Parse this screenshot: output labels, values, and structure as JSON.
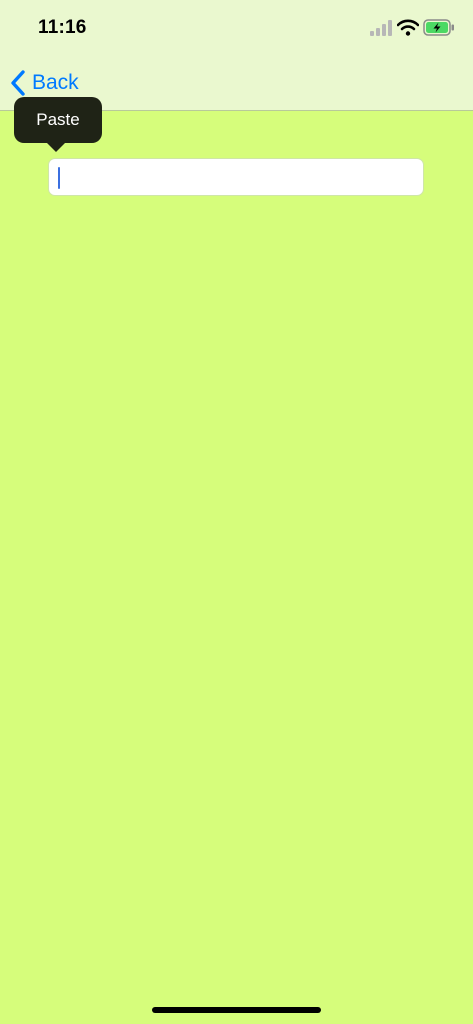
{
  "status_bar": {
    "time": "11:16",
    "icons": [
      "cellular-signal-icon",
      "wifi-icon",
      "battery-charging-icon"
    ]
  },
  "nav": {
    "back_label": "Back",
    "back_icon": "chevron-left-icon"
  },
  "edit_menu": {
    "paste_label": "Paste"
  },
  "text_field": {
    "value": ""
  },
  "colors": {
    "background": "#d6fd7b",
    "top_bar": "#eaf8cf",
    "accent": "#007aff",
    "menu_background": "#1f2316",
    "battery_fill": "#4cd964"
  }
}
